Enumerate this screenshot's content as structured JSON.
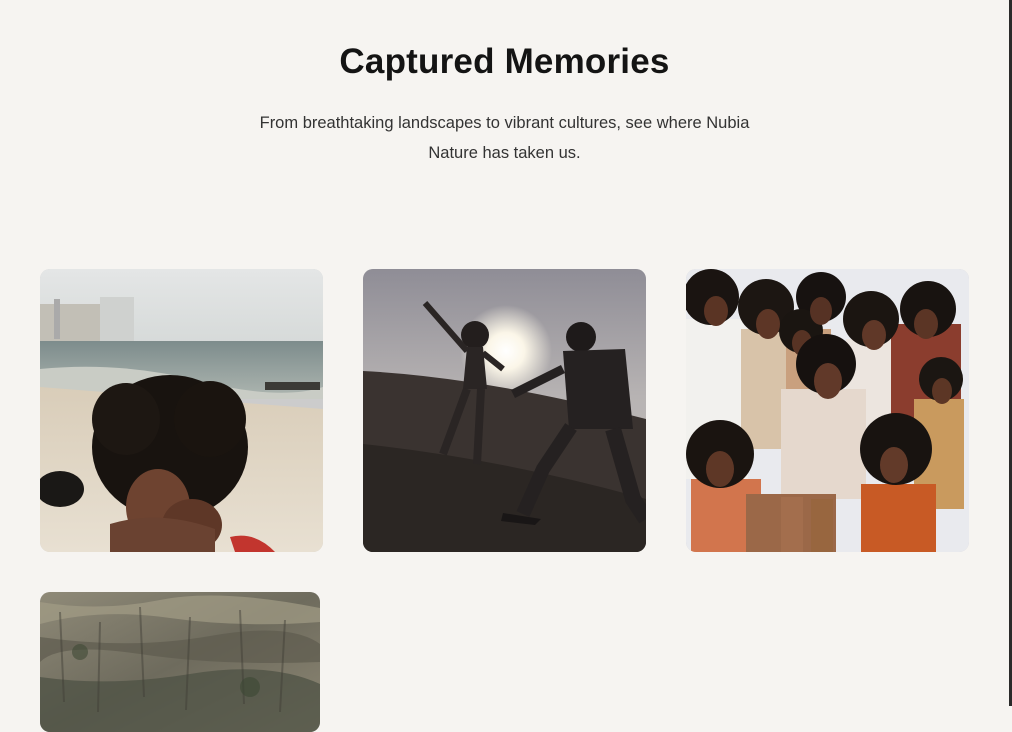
{
  "section": {
    "title": "Captured Memories",
    "subtitle": "From breathtaking landscapes to vibrant cultures, see where Nubia Nature has taken us."
  },
  "gallery": {
    "items": [
      {
        "id": "beach-portrait",
        "icon": "photo-beach-portrait"
      },
      {
        "id": "silhouette-sunset",
        "icon": "photo-silhouette-sunset"
      },
      {
        "id": "group-photo",
        "icon": "photo-group"
      },
      {
        "id": "rock-texture",
        "icon": "photo-rock-texture"
      }
    ]
  },
  "colors": {
    "background": "#f6f4f1",
    "title": "#141414",
    "text": "#333333"
  }
}
